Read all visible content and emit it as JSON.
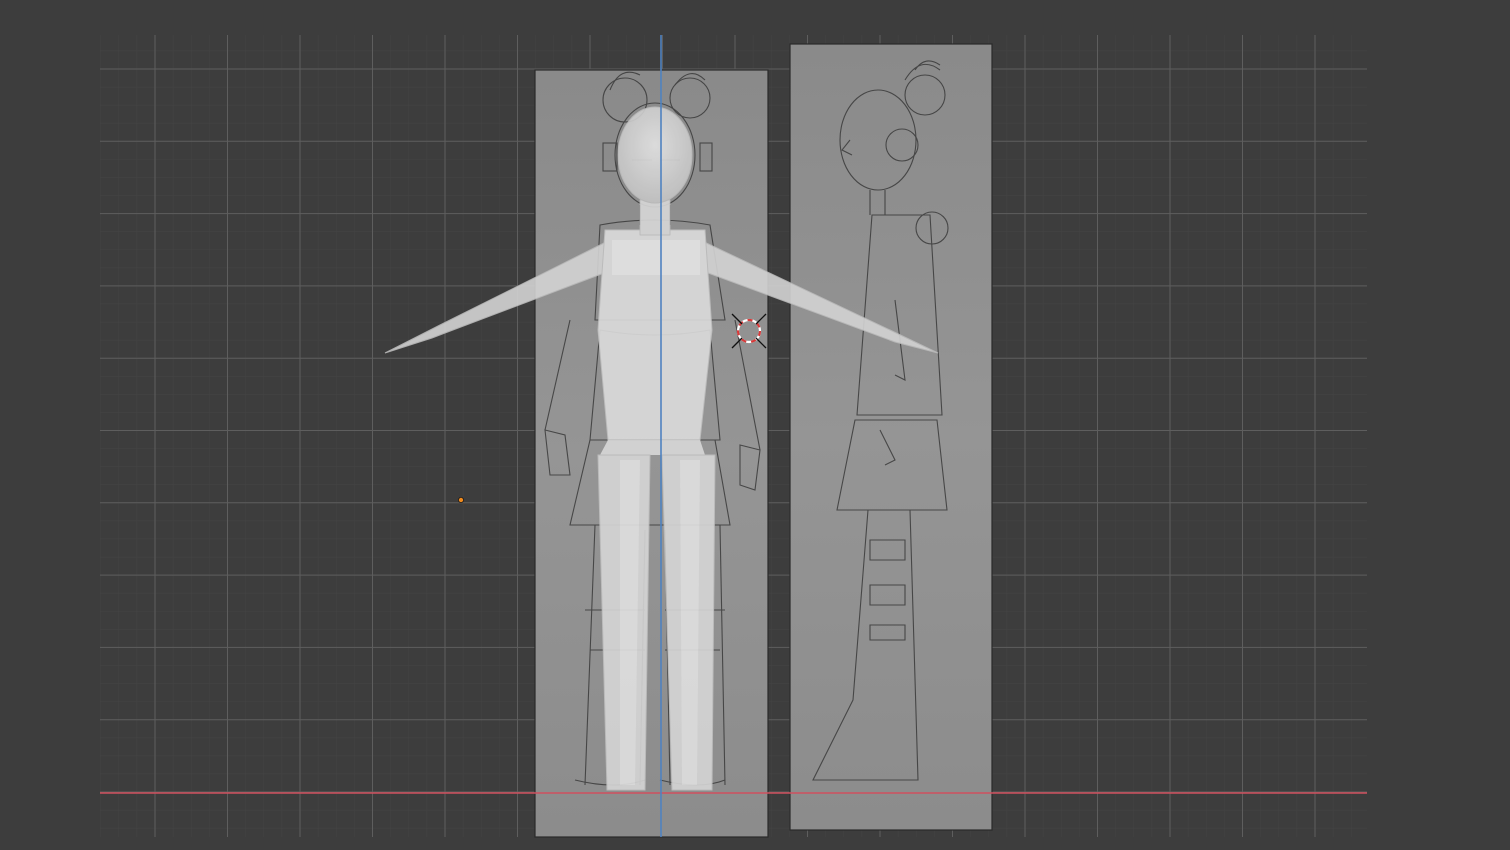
{
  "viewport": {
    "background": "#3d3d3d",
    "grid_minor_color": "#444444",
    "grid_major_color": "#5e5e5e",
    "x_axis_color": "#d0505e",
    "z_axis_color": "#4f82c0"
  },
  "references": [
    {
      "name": "front-reference-image",
      "view": "front"
    },
    {
      "name": "side-reference-image",
      "view": "side"
    }
  ],
  "mesh": {
    "name": "character-base-mesh",
    "pose": "T-pose",
    "color": "#d6d6d6"
  },
  "cursor": {
    "name": "3d-cursor-icon",
    "colors": [
      "#d83a3a",
      "#ffffff"
    ]
  },
  "origin": {
    "name": "object-origin-dot",
    "color": "#f08a1d"
  }
}
